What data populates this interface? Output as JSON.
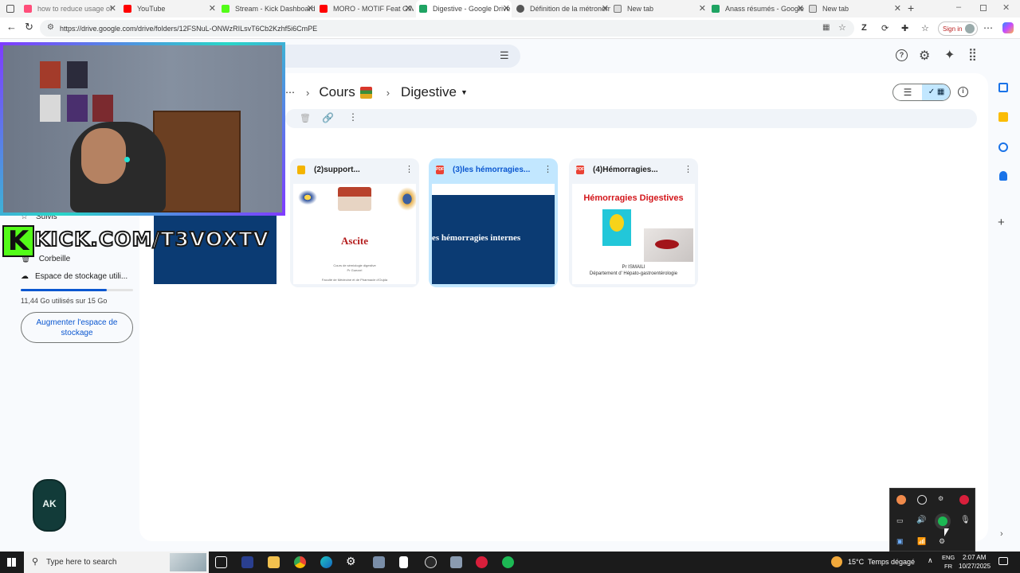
{
  "browser": {
    "tabs": [
      {
        "title": "how to reduce usage of",
        "color": "#ff4e7a"
      },
      {
        "title": "YouTube",
        "color": "#ff0000"
      },
      {
        "title": "Stream - Kick Dashboard",
        "color": "#53fc18"
      },
      {
        "title": "MORO - MOTIF Feat GIMS",
        "color": "#ff0000"
      },
      {
        "title": "Digestive - Google Drive",
        "color": "#1fa463"
      },
      {
        "title": "Définition de la métronomie",
        "color": "#555555"
      },
      {
        "title": "New tab",
        "color": "#777777"
      },
      {
        "title": "Anass résumés - Google",
        "color": "#1fa463"
      },
      {
        "title": "New tab",
        "color": "#777777"
      }
    ],
    "url": "https://drive.google.com/drive/folders/12FSNuL-ONWzRILsvT6Cb2Kzhf5i6CmPE",
    "signin_label": "Sign in"
  },
  "drive": {
    "breadcrumb": {
      "parent": "Cours",
      "current": "Digestive"
    },
    "files": [
      {
        "title": "(2)support...",
        "type": "slides",
        "type_color": "#f4b400",
        "thumb_title": "Ascite",
        "thumb_sub": "Cours de sémiologie digestive",
        "thumb_author": "Pr Guezzri",
        "thumb_footer": "Faculté de Médecine et de Pharmacie d'Oujda"
      },
      {
        "title": "(3)les hémorragies...",
        "type": "pdf",
        "type_color": "#ea4335",
        "type_label": "PDF",
        "thumb_title": "es hémorragies internes",
        "selected": true
      },
      {
        "title": "(4)Hémorragies...",
        "type": "pdf",
        "type_color": "#ea4335",
        "type_label": "PDF",
        "thumb_title": "Hémorragies Digestives",
        "thumb_author": "Pr ISMAILI",
        "thumb_footer": "Département d' Hépato-gastroentérologie"
      }
    ],
    "nav": {
      "suivis": "Suivis",
      "corbeille": "Corbeille",
      "storage": "Espace de stockage utili...",
      "usage": "11,44 Go utilisés sur 15 Go",
      "usage_fraction": 0.763,
      "upgrade": "Augmenter l'espace de stockage"
    }
  },
  "overlay": {
    "kick_text": "KICK.COM/T3VOXTV",
    "badge_text": "AK"
  },
  "taskbar": {
    "search_placeholder": "Type here to search",
    "weather": "15°C  Temps dégagé",
    "lang_top": "ENG",
    "lang_bottom": "FR",
    "time": "2:07 AM",
    "date": "10/27/2025"
  }
}
